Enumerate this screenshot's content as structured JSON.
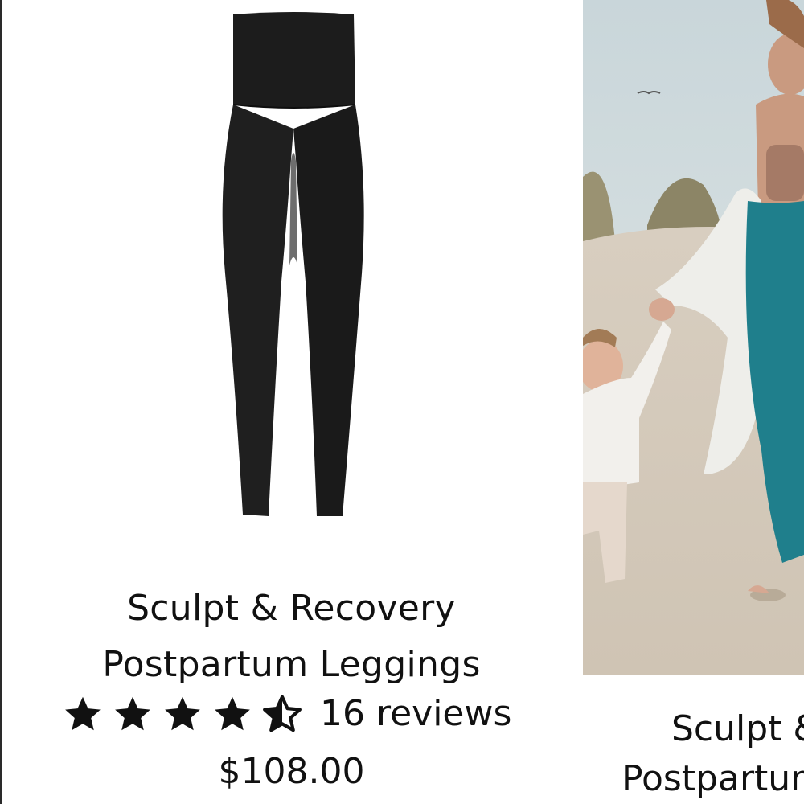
{
  "products": [
    {
      "title_line1": "Sculpt & Recovery",
      "title_line2": "Postpartum Leggings",
      "rating": 4.5,
      "rating_max": 5,
      "reviews": "16 reviews",
      "price": "$108.00",
      "image_icon": "black-leggings-image"
    },
    {
      "title_line1": "Sculpt &",
      "title_line2": "Postpartum",
      "image_icon": "beach-photo-image"
    }
  ],
  "colors": {
    "text": "#111111",
    "legging": "#1c1c1c",
    "teal_legging": "#1f7f8c",
    "sand": "#d9cfc1"
  }
}
